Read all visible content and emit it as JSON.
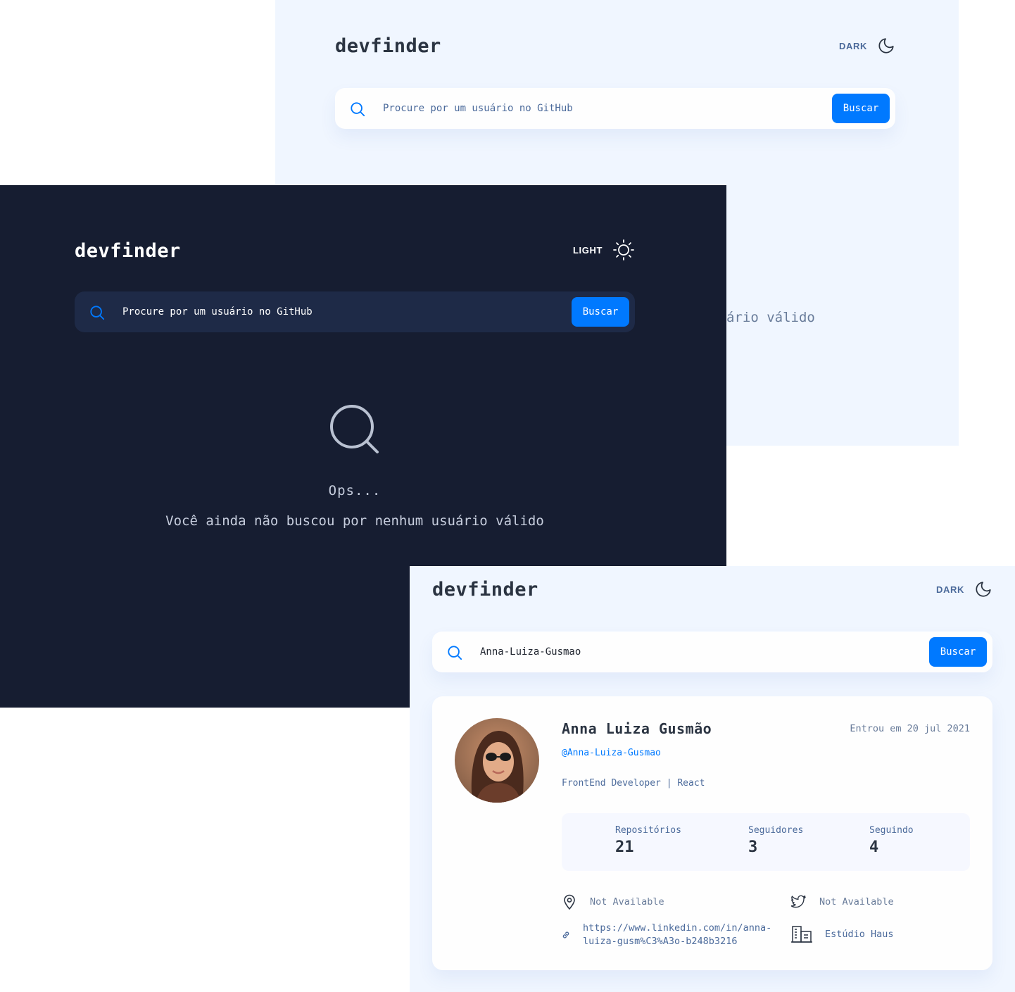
{
  "app": {
    "logo": "devfinder"
  },
  "screens": {
    "light_empty": {
      "theme_label": "DARK",
      "search_placeholder": "Procure por um usuário no GitHub",
      "button_label": "Buscar",
      "partial_message": "ário válido"
    },
    "dark_empty": {
      "theme_label": "LIGHT",
      "search_placeholder": "Procure por um usuário no GitHub",
      "button_label": "Buscar",
      "ops": "Ops...",
      "message": "Você ainda não buscou por nenhum usuário válido"
    },
    "light_result": {
      "theme_label": "DARK",
      "search_value": "Anna-Luiza-Gusmao",
      "button_label": "Buscar",
      "profile": {
        "name": "Anna Luiza Gusmão",
        "joined": "Entrou em 20 jul 2021",
        "login": "@Anna-Luiza-Gusmao",
        "bio": "FrontEnd Developer | React",
        "stats": [
          {
            "label": "Repositórios",
            "value": "21"
          },
          {
            "label": "Seguidores",
            "value": "3"
          },
          {
            "label": "Seguindo",
            "value": "4"
          }
        ],
        "location": "Not Available",
        "twitter": "Not Available",
        "blog_line1": "https://www.linkedin.com/in/anna-",
        "blog_line2": "luiza-gusm%C3%A3o-b248b3216",
        "company": "Estúdio Haus"
      }
    }
  },
  "icons": {
    "moon": "moon-icon",
    "sun": "sun-icon",
    "search": "search-icon",
    "location": "location-icon",
    "twitter": "twitter-icon",
    "link": "link-icon",
    "company": "company-icon"
  },
  "colors": {
    "accent": "#0079ff",
    "dark_bg": "#161d31",
    "dark_surface": "#1e2a47",
    "light_bg": "#f0f6ff"
  }
}
